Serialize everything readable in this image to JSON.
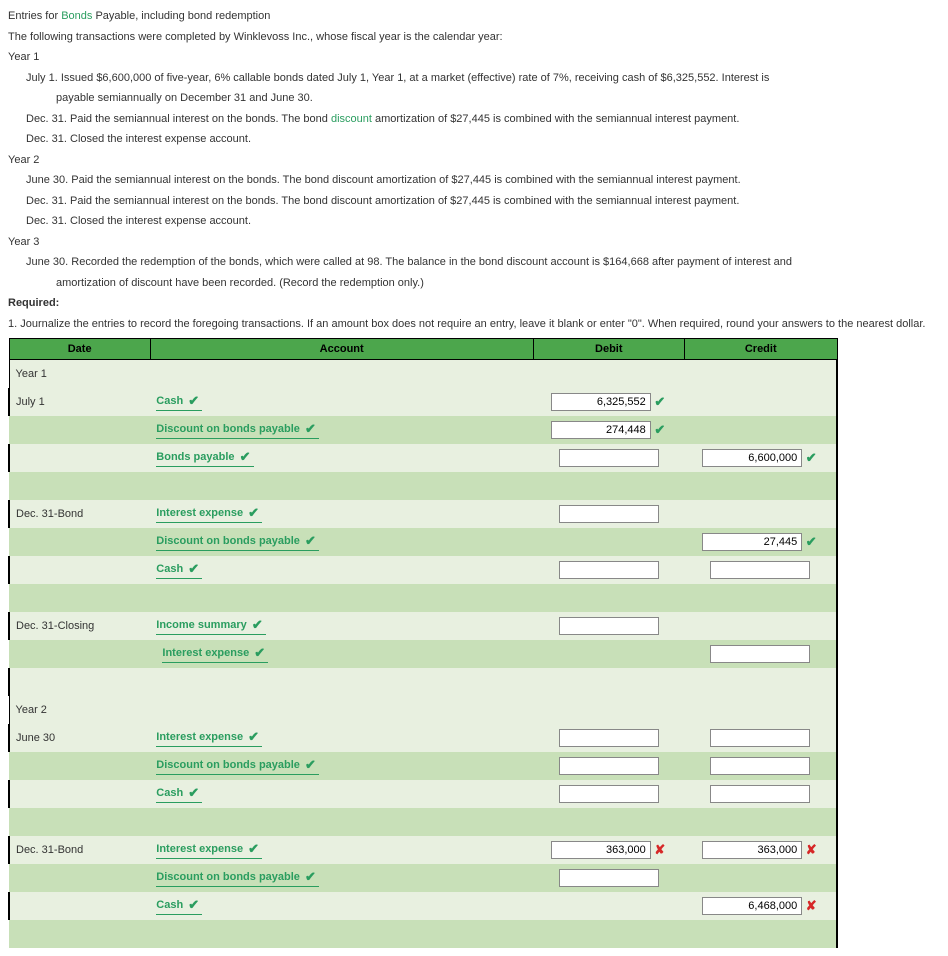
{
  "intro": {
    "title_pre": "Entries for ",
    "title_green": "Bonds",
    "title_post": " Payable, including bond redemption",
    "line1": "The following transactions were completed by Winklevoss Inc., whose fiscal year is the calendar year:",
    "y1": "Year 1",
    "y1_jul1a": "July 1. Issued $6,600,000 of five-year, 6% callable bonds dated July 1, Year 1, at a market (effective) rate of 7%, receiving cash of $6,325,552. Interest is",
    "y1_jul1b": "payable semiannually on December 31 and June 30.",
    "y1_dec31a_pre": "Dec. 31. Paid the semiannual interest on the bonds. The bond ",
    "y1_dec31a_green": "discount",
    "y1_dec31a_post": " amortization of $27,445 is combined with the semiannual interest payment.",
    "y1_dec31b": "Dec. 31. Closed the interest expense account.",
    "y2": "Year 2",
    "y2_jun30": "June 30. Paid the semiannual interest on the bonds. The bond discount amortization of $27,445 is combined with the semiannual interest payment.",
    "y2_dec31a": "Dec. 31. Paid the semiannual interest on the bonds. The bond discount amortization of $27,445 is combined with the semiannual interest payment.",
    "y2_dec31b": "Dec. 31. Closed the interest expense account.",
    "y3": "Year 3",
    "y3_jun30a": "June 30. Recorded the redemption of the bonds, which were called at 98. The balance in the bond discount account is $164,668 after payment of interest and",
    "y3_jun30b": "amortization of discount have been recorded. (Record the redemption only.)",
    "required": "Required:",
    "req1": "1. Journalize the entries to record the foregoing transactions. If an amount box does not require an entry, leave it blank or enter \"0\". When required, round your answers to the nearest dollar."
  },
  "headers": {
    "date": "Date",
    "account": "Account",
    "debit": "Debit",
    "credit": "Credit"
  },
  "labels": {
    "year1": "Year 1",
    "year2": "Year 2",
    "july1": "July 1",
    "dec31bond": "Dec. 31-Bond",
    "dec31closing": "Dec. 31-Closing",
    "june30": "June 30",
    "cash": "Cash",
    "discount": "Discount on bonds payable",
    "bondspay": "Bonds payable",
    "intexp": "Interest expense",
    "incsum": "Income summary"
  },
  "values": {
    "v1": "6,325,552",
    "v2": "274,448",
    "v3": "6,600,000",
    "v4": "27,445",
    "v5": "363,000",
    "v6": "363,000",
    "v7": "6,468,000"
  },
  "marks": {
    "check": "✔",
    "cross": "✘"
  }
}
